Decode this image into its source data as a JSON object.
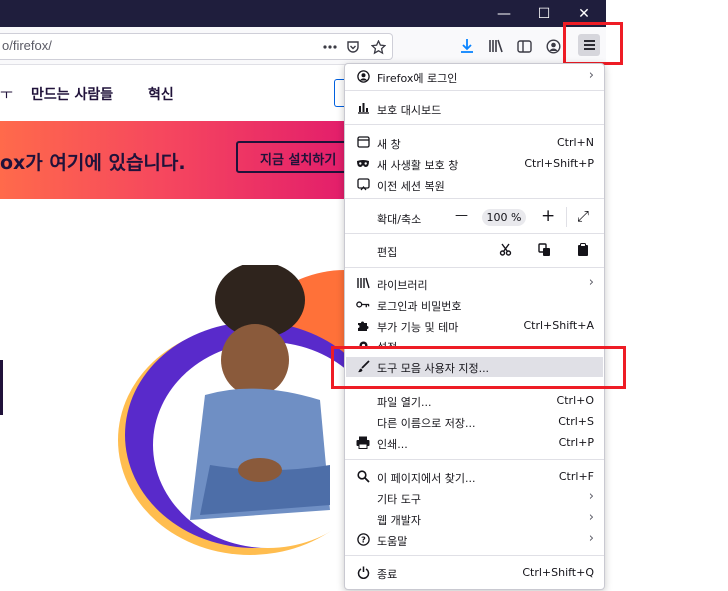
{
  "window": {
    "minimize": "—",
    "maximize": "☐",
    "close": "✕"
  },
  "toolbar": {
    "url": "o/firefox/",
    "icons": [
      "page-actions-icon",
      "pocket-icon",
      "bookmark-star-icon",
      "download-icon",
      "library-icon",
      "sidebar-icon",
      "account-icon",
      "hamburger-menu-icon"
    ]
  },
  "page": {
    "nav": [
      "만드는 사람들",
      "혁신"
    ],
    "nav_partial": "ㅜ",
    "banner_text": "ox가 여기에 있습니다.",
    "banner_button": "지금 설치하기"
  },
  "menu": {
    "signin": "Firefox에 로그인",
    "protection_dashboard": "보호 대시보드",
    "new_window": {
      "label": "새 창",
      "shortcut": "Ctrl+N"
    },
    "new_private": {
      "label": "새 사생활 보호 창",
      "shortcut": "Ctrl+Shift+P"
    },
    "restore_session": "이전 세션 복원",
    "zoom": {
      "label": "확대/축소",
      "minus": "—",
      "value": "100 %",
      "plus": "+",
      "fullscreen": "⤢"
    },
    "edit": {
      "label": "편집"
    },
    "library": "라이브러리",
    "logins": "로그인과 비밀번호",
    "addons": {
      "label": "부가 기능 및 테마",
      "shortcut": "Ctrl+Shift+A"
    },
    "settings_partial": "설정",
    "customize": "도구 모음 사용자 지정...",
    "open_file": {
      "label": "파일 열기...",
      "shortcut": "Ctrl+O"
    },
    "save_as": {
      "label": "다른 이름으로 저장...",
      "shortcut": "Ctrl+S"
    },
    "print": {
      "label": "인쇄...",
      "shortcut": "Ctrl+P"
    },
    "find": {
      "label": "이 페이지에서 찾기...",
      "shortcut": "Ctrl+F"
    },
    "more_tools": "기타 도구",
    "web_dev": "웹 개발자",
    "help": "도움말",
    "quit": {
      "label": "종료",
      "shortcut": "Ctrl+Shift+Q"
    }
  },
  "colors": {
    "annotation_red": "#ee1c25",
    "titlebar": "#1f1e3d",
    "accent_blue": "#0060df"
  }
}
